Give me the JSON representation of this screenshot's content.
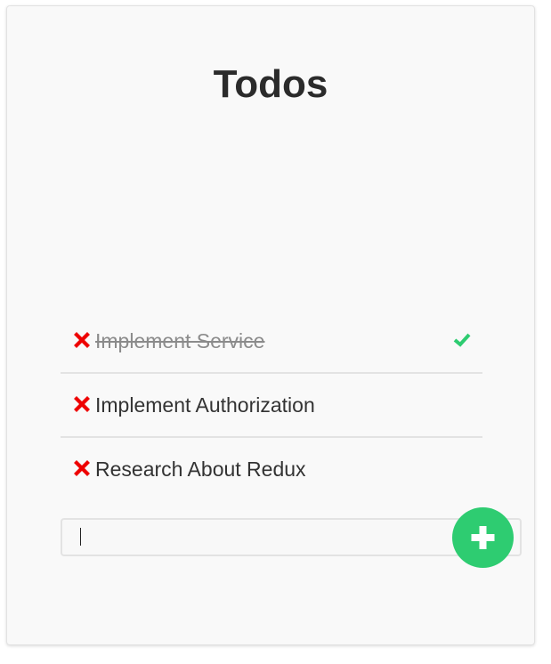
{
  "app": {
    "title": "Todos"
  },
  "todos": [
    {
      "text": "Implement Service",
      "completed": true
    },
    {
      "text": "Implement Authorization",
      "completed": false
    },
    {
      "text": "Research About Redux",
      "completed": false
    }
  ],
  "new_todo": {
    "value": "",
    "placeholder": ""
  },
  "icons": {
    "delete": "x-icon",
    "complete": "checkmark-icon",
    "add": "plus-icon"
  },
  "colors": {
    "delete": "#ee0000",
    "complete": "#2ecc71",
    "add_button": "#2ecc71",
    "completed_text": "#8b8b8b"
  }
}
